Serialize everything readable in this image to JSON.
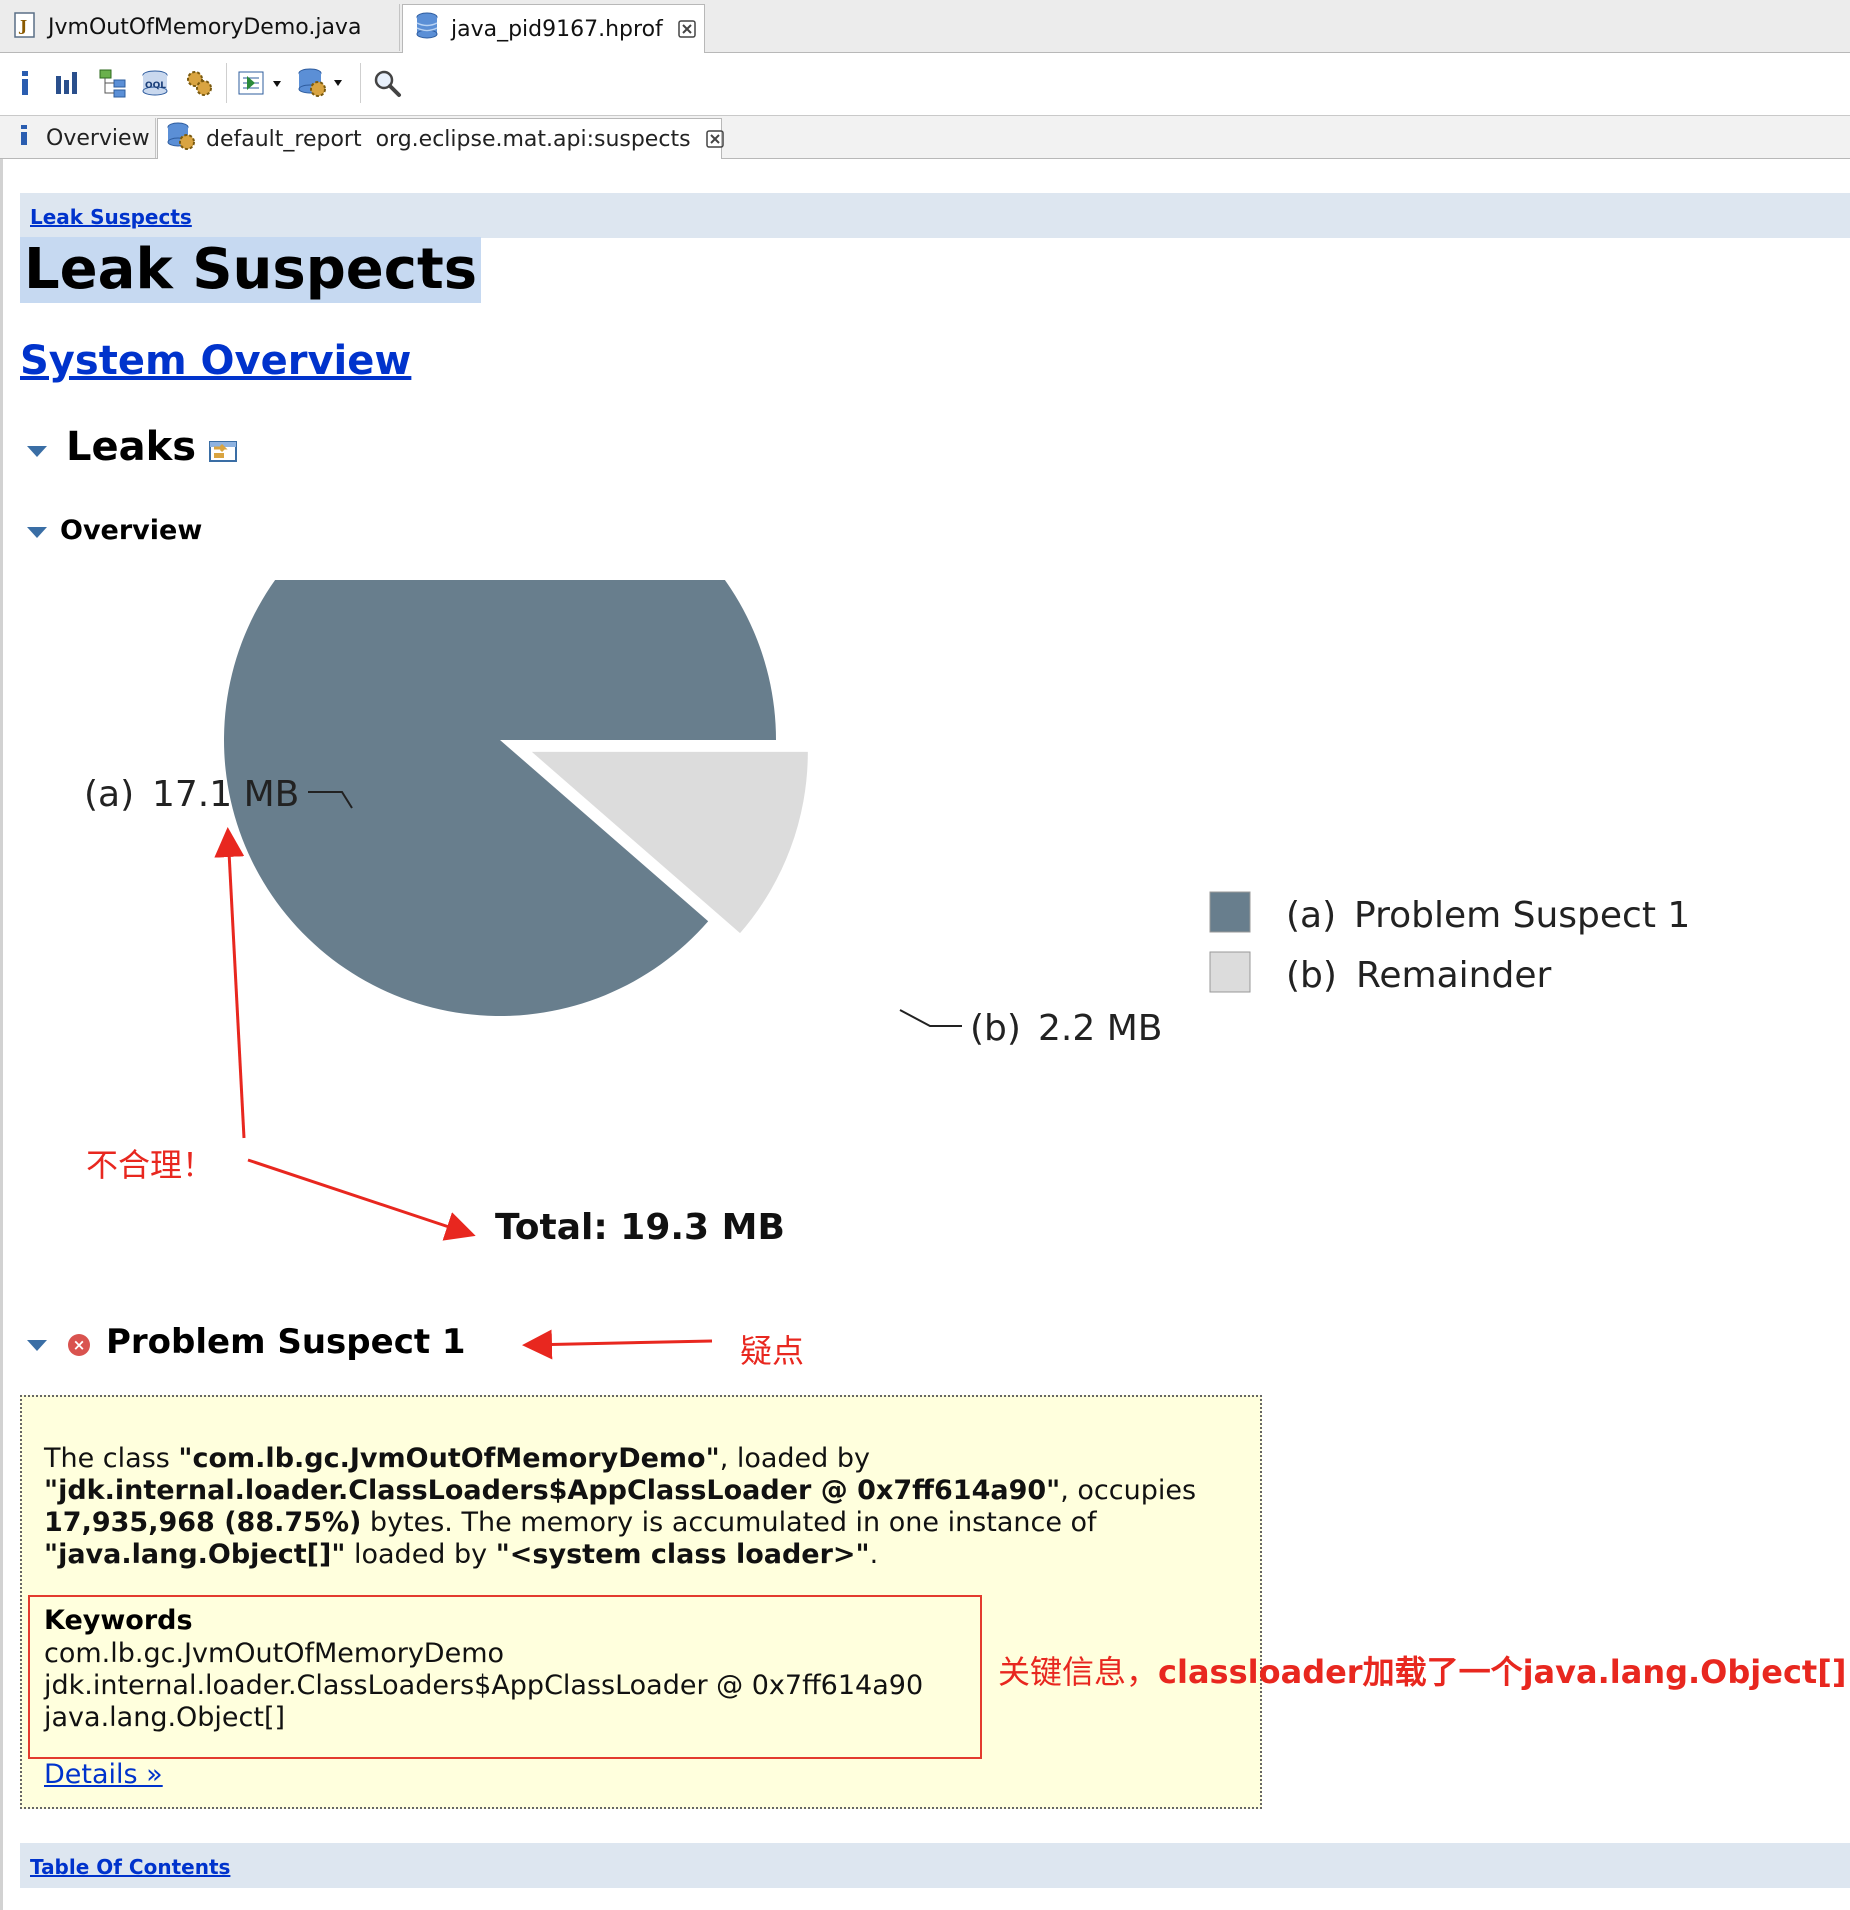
{
  "editor_tabs": [
    {
      "label": "JvmOutOfMemoryDemo.java",
      "icon": "java-file-icon",
      "active": false
    },
    {
      "label": "java_pid9167.hprof",
      "icon": "heap-dump-icon",
      "active": true
    }
  ],
  "toolbar": {
    "buttons": [
      "info-icon",
      "histogram-icon",
      "dominator-tree-icon",
      "oql-icon",
      "thread-overview-icon",
      "run-expert-report-icon",
      "query-browser-icon",
      "search-icon"
    ]
  },
  "inner_tabs": [
    {
      "label": "Overview",
      "icon": "info-icon"
    },
    {
      "label": "default_report  org.eclipse.mat.api:suspects",
      "icon": "report-icon",
      "active": true
    }
  ],
  "report": {
    "breadcrumb": "Leak Suspects",
    "title": "Leak Suspects",
    "system_overview_link": "System Overview",
    "leaks_heading": "Leaks",
    "overview_heading": "Overview",
    "problem_suspect_heading": "Problem Suspect 1",
    "description": {
      "p1": "The class ",
      "b1": "\"com.lb.gc.JvmOutOfMemoryDemo\"",
      "p2": ", loaded by ",
      "b2": "\"jdk.internal.loader.ClassLoaders$AppClassLoader @ 0x7ff614a90\"",
      "p3": ", occupies ",
      "b3": "17,935,968 (88.75%)",
      "p4": " bytes. The memory is accumulated in one instance of ",
      "b4": "\"java.lang.Object[]\"",
      "p5": " loaded by ",
      "b5": "\"<system class loader>\"",
      "p6": "."
    },
    "keywords_title": "Keywords",
    "keywords": [
      "com.lb.gc.JvmOutOfMemoryDemo",
      "jdk.internal.loader.ClassLoaders$AppClassLoader @ 0x7ff614a90",
      "java.lang.Object[]"
    ],
    "details_link": "Details »",
    "table_of_contents": "Table Of Contents"
  },
  "chart_data": {
    "type": "pie",
    "slices": [
      {
        "key": "(a)",
        "label": "Problem Suspect 1",
        "value": 17.1,
        "value_label": "17.1 MB",
        "color": "#687e8d",
        "exploded": false
      },
      {
        "key": "(b)",
        "label": "Remainder",
        "value": 2.2,
        "value_label": "2.2 MB",
        "color": "#dcdcdc",
        "exploded": true
      }
    ],
    "total_label": "Total: 19.3 MB",
    "legend_position": "right"
  },
  "annotations": {
    "unreasonable": "不合理！",
    "doubt": "疑点",
    "key_info_prefix": "关键信息，",
    "key_info_text": "classloader加载了一个java.lang.Object[]",
    "color": "#e8271f"
  }
}
